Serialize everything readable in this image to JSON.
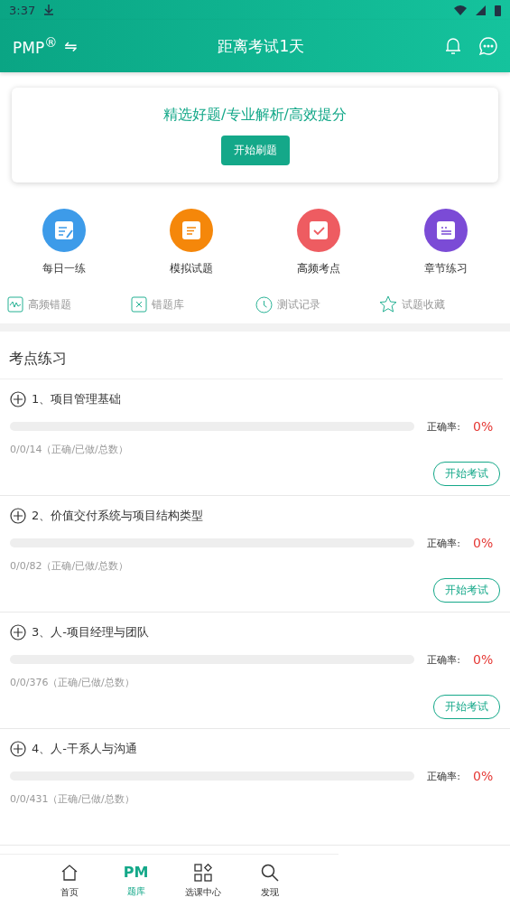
{
  "status_bar": {
    "time": "3:37"
  },
  "header": {
    "brand": "PMP",
    "brand_mark": "®",
    "switch_glyph": "⇋",
    "title": "距离考试1天"
  },
  "banner": {
    "slogan": "精选好题/专业解析/高效提分",
    "button": "开始刷题"
  },
  "features": [
    {
      "label": "每日一练",
      "kind": "edit",
      "color": "#3d9be9"
    },
    {
      "label": "模拟试题",
      "kind": "doc",
      "color": "#f5870a"
    },
    {
      "label": "高频考点",
      "kind": "check",
      "color": "#ee5c61"
    },
    {
      "label": "章节练习",
      "kind": "list",
      "color": "#7b4bd6"
    }
  ],
  "tools": [
    {
      "label": "高频错题",
      "kind": "wave"
    },
    {
      "label": "错题库",
      "kind": "cross"
    },
    {
      "label": "测试记录",
      "kind": "clock"
    },
    {
      "label": "试题收藏",
      "kind": "star"
    }
  ],
  "section_title": "考点练习",
  "chapters": [
    {
      "title": "1、项目管理基础",
      "level": 0,
      "rate_label": "正确率:",
      "rate": "0%",
      "counts": "0/0/14（正确/已做/总数）",
      "button": "开始考试"
    },
    {
      "title": "2、价值交付系统与项目结构类型",
      "level": 0,
      "rate_label": "正确率:",
      "rate": "0%",
      "counts": "0/0/82（正确/已做/总数）",
      "button": "开始考试"
    },
    {
      "title": "3、人-项目经理与团队",
      "level": 0,
      "rate_label": "正确率:",
      "rate": "0%",
      "counts": "0/0/376（正确/已做/总数）",
      "button": "开始考试"
    },
    {
      "title": "4、人-干系人与沟通",
      "level": 0,
      "rate_label": "正确率:",
      "rate": "0%",
      "counts": "0/0/431（正确/已做/总数）"
    }
  ],
  "nav": [
    {
      "label": "首页",
      "kind": "home",
      "selected": false
    },
    {
      "label": "题库",
      "kind": "pm",
      "glyph": "PM",
      "selected": true
    },
    {
      "label": "选课中心",
      "kind": "grid",
      "selected": false
    },
    {
      "label": "发现",
      "kind": "search",
      "selected": false
    }
  ]
}
